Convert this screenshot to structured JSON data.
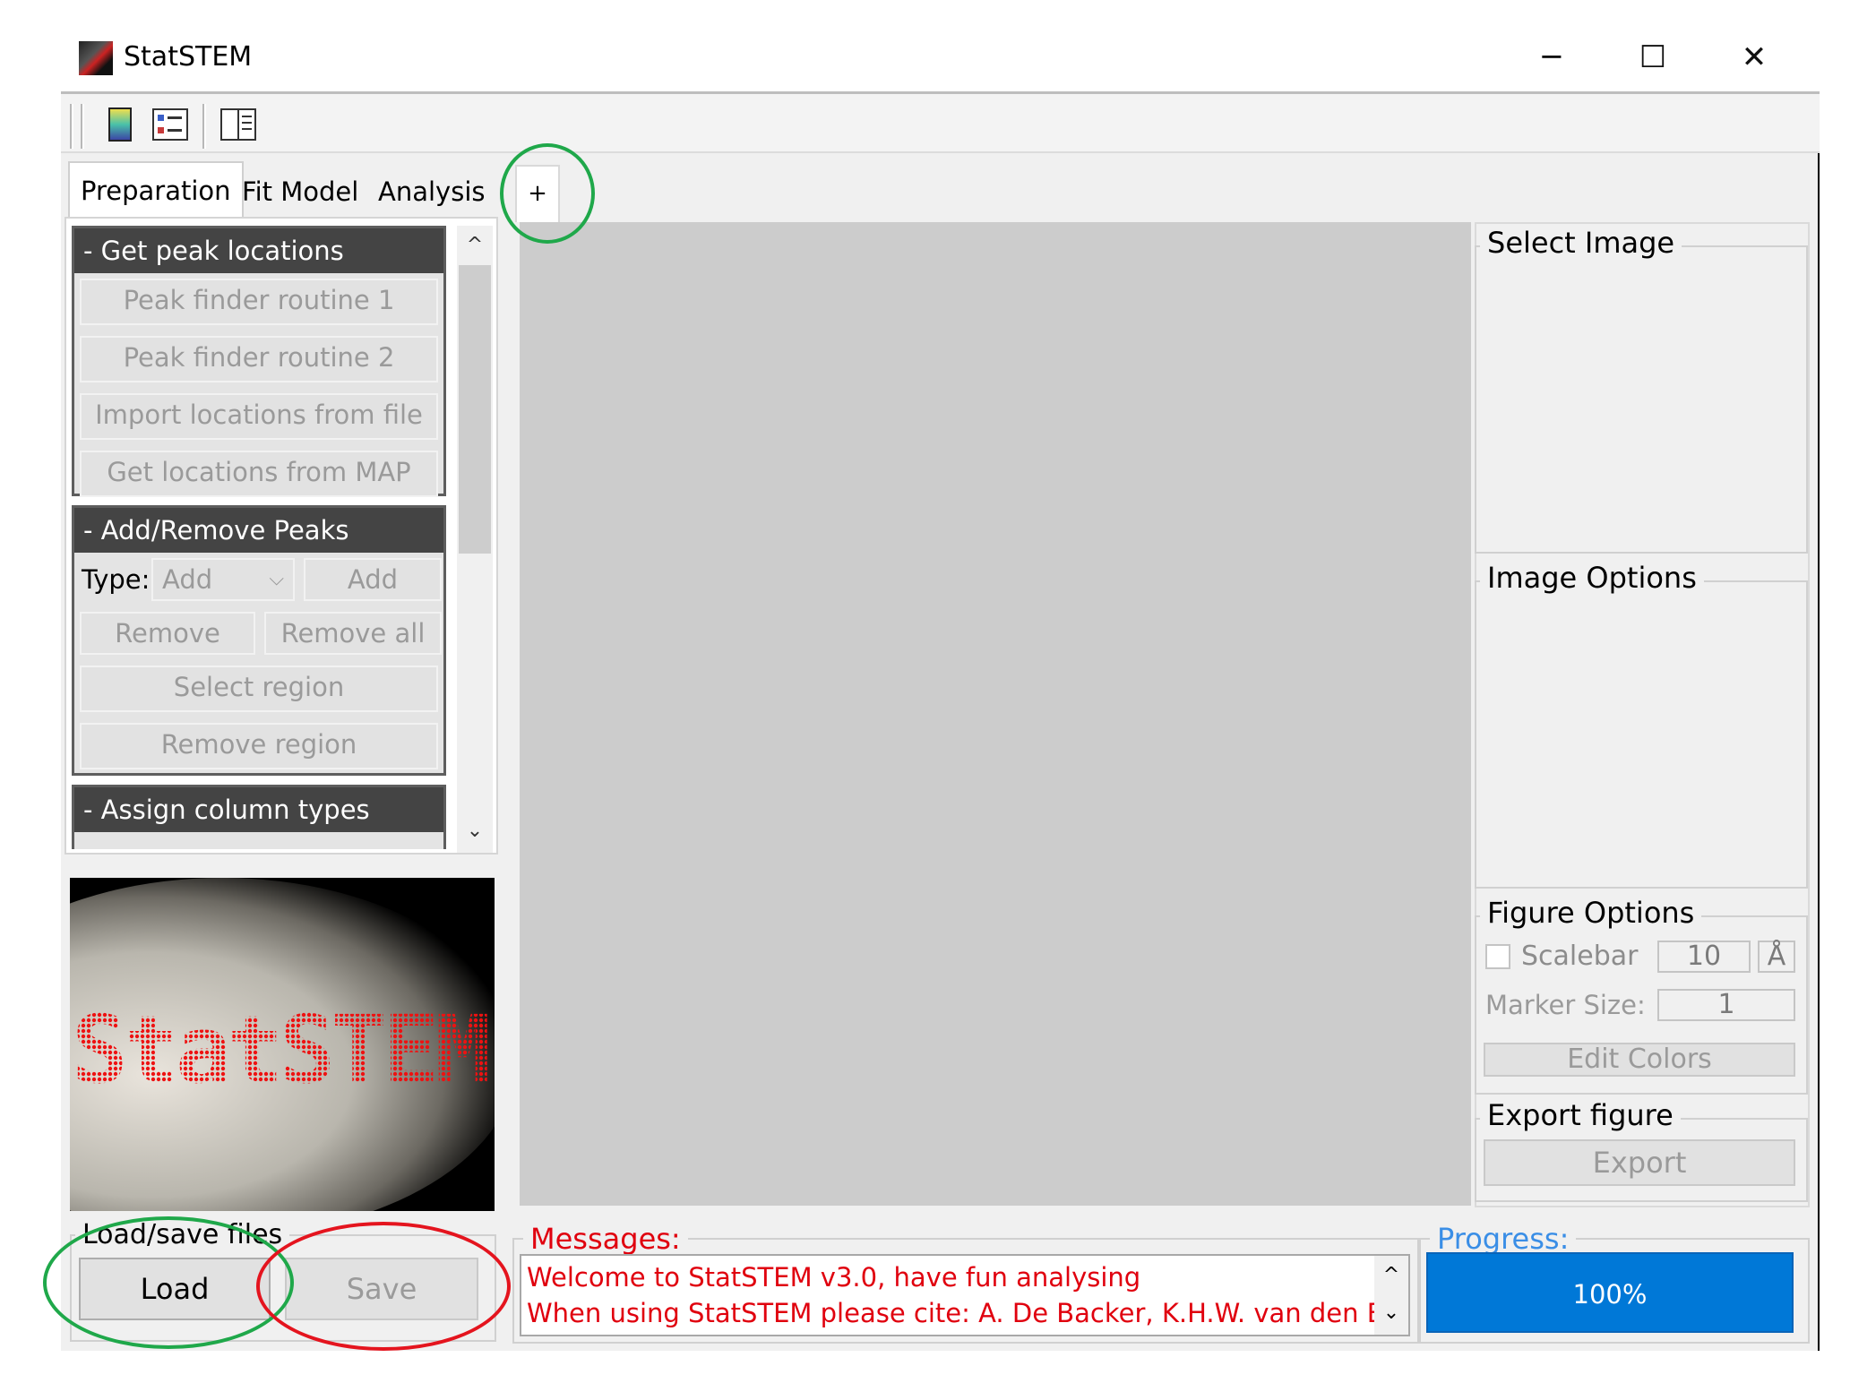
{
  "window": {
    "title": "StatSTEM",
    "controls": {
      "minimize": "─",
      "maximize": "☐",
      "close": "✕"
    }
  },
  "tabs": [
    {
      "label": "Preparation",
      "active": true
    },
    {
      "label": "Fit Model",
      "active": false
    },
    {
      "label": "Analysis",
      "active": false
    }
  ],
  "panels": {
    "get_peaks": {
      "title": "- Get peak locations",
      "buttons": [
        "Peak finder routine 1",
        "Peak finder routine 2",
        "Import locations from file",
        "Get locations from MAP"
      ]
    },
    "add_remove": {
      "title": "- Add/Remove Peaks",
      "type_label": "Type:",
      "type_value": "Add",
      "add_button": "Add",
      "remove": "Remove",
      "remove_all": "Remove all",
      "select_region": "Select region",
      "remove_region": "Remove region"
    },
    "assign": {
      "title": "- Assign column types"
    }
  },
  "logo_text": "StatSTEM",
  "loadsave": {
    "title": "Load/save files",
    "load": "Load",
    "save": "Save"
  },
  "figure_tabs": {
    "plus": "+"
  },
  "right_panel": {
    "select_image": "Select Image",
    "image_options": "Image Options",
    "figure_options": {
      "title": "Figure Options",
      "scalebar": "Scalebar",
      "scalebar_value": "10",
      "scalebar_unit": "Å",
      "marker_size_label": "Marker Size:",
      "marker_size_value": "1",
      "edit_colors": "Edit Colors"
    },
    "export_figure": {
      "title": "Export figure",
      "export": "Export"
    }
  },
  "messages": {
    "title": "Messages:",
    "lines": [
      "Welcome to StatSTEM v3.0, have fun analysing",
      "When using StatSTEM please cite: A. De Backer, K.H.W. van den Bos, et."
    ]
  },
  "progress": {
    "title": "Progress:",
    "value_text": "100%",
    "value": 1.0
  },
  "annotation_colors": {
    "green": "#1fa84a",
    "red": "#e4141e",
    "progress": "#0078d7"
  }
}
